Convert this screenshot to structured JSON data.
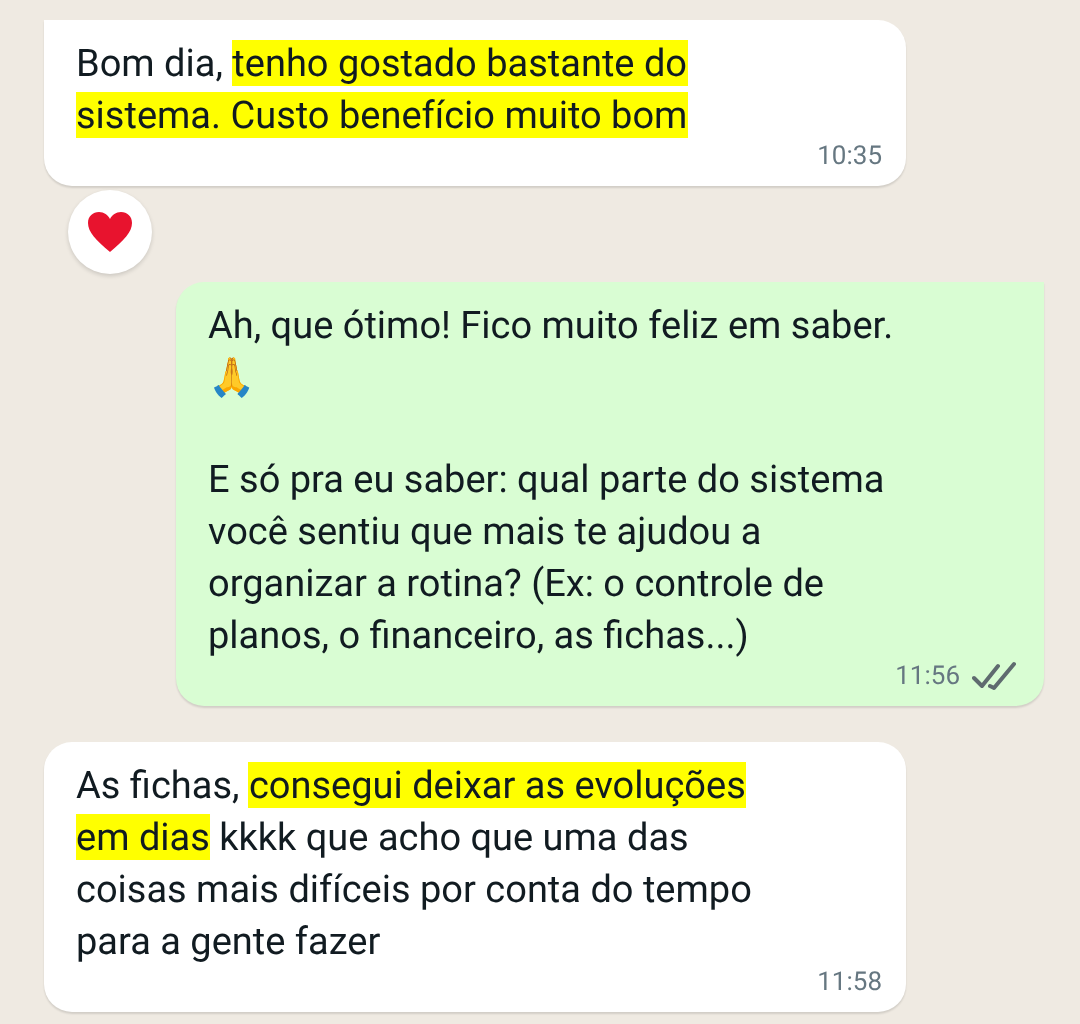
{
  "messages": [
    {
      "outgoing": false,
      "tail": true,
      "paragraphs": [
        [
          {
            "text": "Bom dia, ",
            "highlighted": false
          },
          {
            "text": "tenho gostado bastante do sistema. Custo benefício muito bom",
            "highlighted": true
          }
        ]
      ],
      "time": "10:35",
      "reaction": true
    },
    {
      "outgoing": true,
      "tail": true,
      "paragraphs": [
        [
          {
            "text": "Ah, que ótimo! Fico muito feliz em saber. 🙏",
            "highlighted": false
          }
        ],
        [
          {
            "text": "E só pra eu saber: qual parte do sistema você sentiu que mais te ajudou a organizar a rotina? (Ex: o controle de planos, o financeiro, as fichas...)",
            "highlighted": false
          }
        ]
      ],
      "time": "11:56",
      "ticks": true,
      "reaction": false
    },
    {
      "outgoing": false,
      "tail": false,
      "paragraphs": [
        [
          {
            "text": "As fichas, ",
            "highlighted": false
          },
          {
            "text": "consegui deixar as evoluções em dias",
            "highlighted": true
          },
          {
            "text": " kkkk que acho que uma das coisas mais difíceis por conta do tempo para a gente fazer",
            "highlighted": false
          }
        ]
      ],
      "time": "11:58",
      "reaction": false
    }
  ]
}
